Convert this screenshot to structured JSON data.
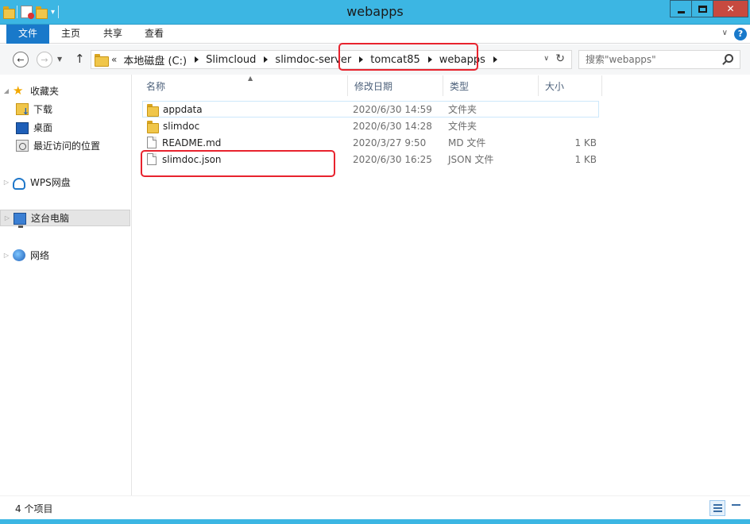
{
  "window": {
    "title": "webapps",
    "accent": "#3cb6e3",
    "qat_dropdown": "▾"
  },
  "ribbon": {
    "tabs": [
      "文件",
      "主页",
      "共享",
      "查看"
    ],
    "expand": "∨",
    "help": "?"
  },
  "address": {
    "overflow": "«",
    "crumbs": [
      "本地磁盘 (C:)",
      "Slimcloud",
      "slimdoc-server",
      "tomcat85",
      "webapps"
    ],
    "dropdown": "∨",
    "refresh": "↻"
  },
  "search": {
    "placeholder": "搜索\"webapps\""
  },
  "nav": {
    "items": [
      {
        "label": "收藏夹",
        "icon": "star-icon"
      },
      {
        "label": "下载",
        "icon": "downloads-folder-icon"
      },
      {
        "label": "桌面",
        "icon": "desktop-icon"
      },
      {
        "label": "最近访问的位置",
        "icon": "recent-places-icon"
      },
      {
        "label": "WPS网盘",
        "icon": "cloud-icon"
      },
      {
        "label": "这台电脑",
        "icon": "computer-icon"
      },
      {
        "label": "网络",
        "icon": "network-icon"
      }
    ]
  },
  "columns": {
    "name": "名称",
    "date": "修改日期",
    "type": "类型",
    "size": "大小"
  },
  "files": [
    {
      "name": "appdata",
      "date": "2020/6/30 14:59",
      "type": "文件夹",
      "size": "",
      "icon": "folder-icon"
    },
    {
      "name": "slimdoc",
      "date": "2020/6/30 14:28",
      "type": "文件夹",
      "size": "",
      "icon": "folder-icon"
    },
    {
      "name": "README.md",
      "date": "2020/3/27 9:50",
      "type": "MD 文件",
      "size": "1 KB",
      "icon": "file-icon"
    },
    {
      "name": "slimdoc.json",
      "date": "2020/6/30 16:25",
      "type": "JSON 文件",
      "size": "1 KB",
      "icon": "file-icon"
    }
  ],
  "status": {
    "item_count": "4 个项目"
  },
  "highlight_color": "#e8232e"
}
